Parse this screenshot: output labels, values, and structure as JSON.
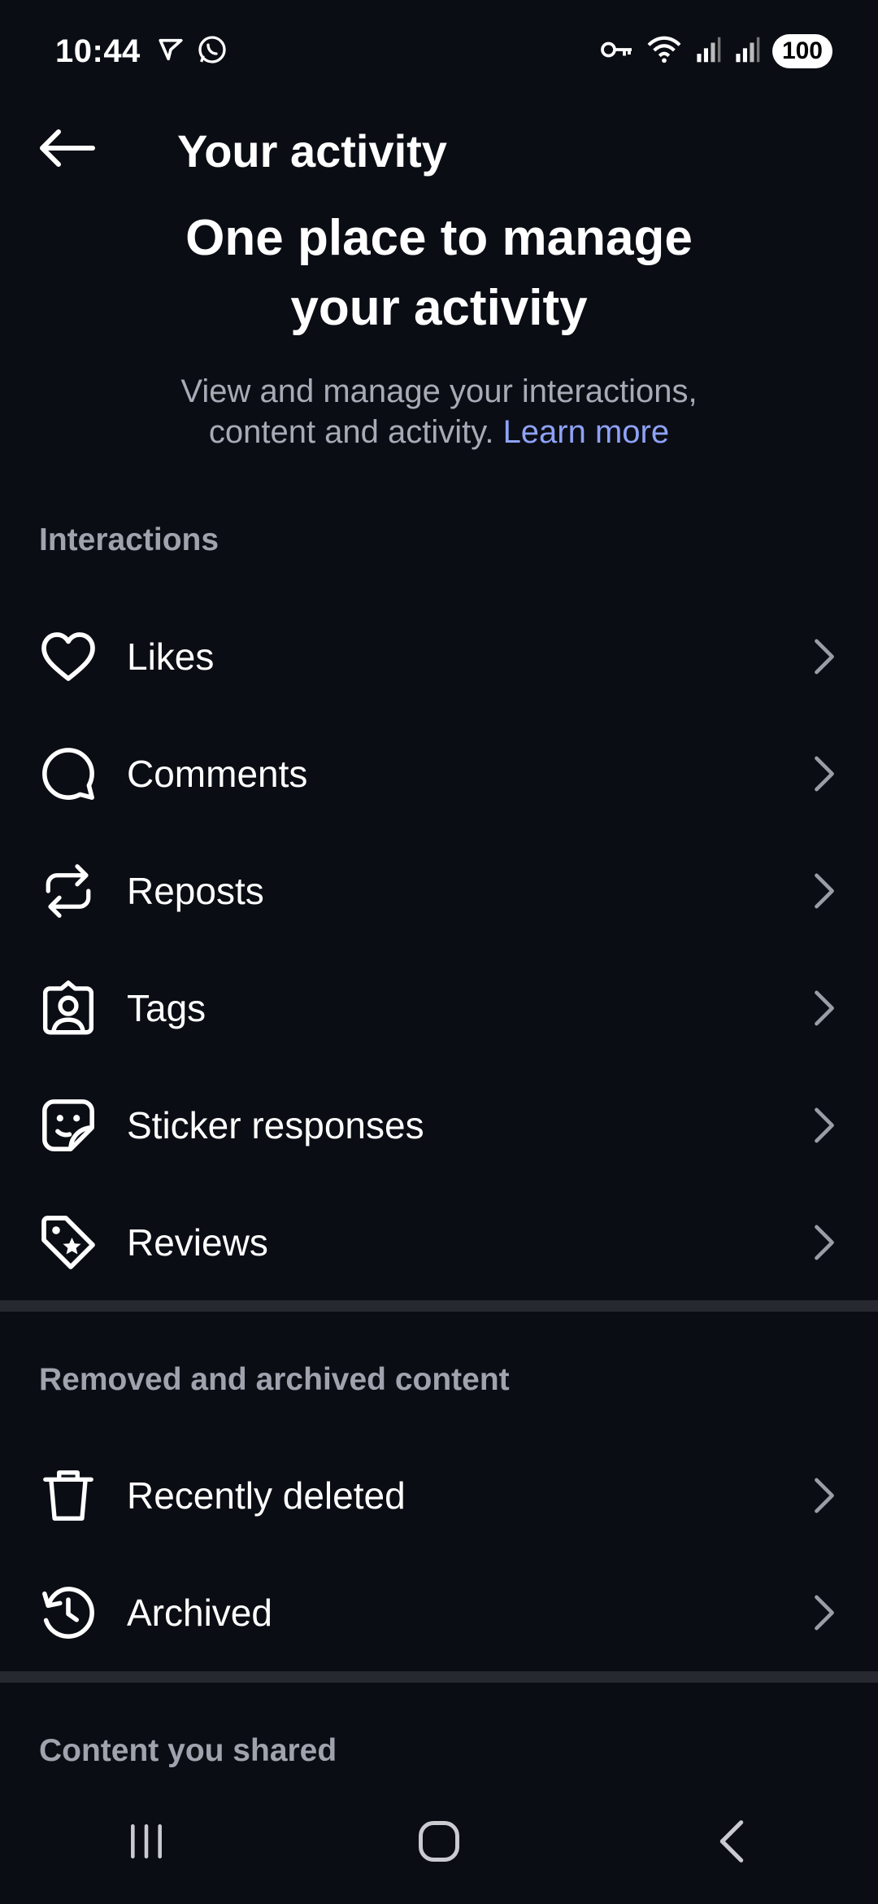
{
  "status_bar": {
    "time": "10:44",
    "battery": "100",
    "icons": [
      "navigation-icon",
      "whatsapp-icon",
      "vpn-key-icon",
      "wifi-icon",
      "signal-icon",
      "signal-icon"
    ]
  },
  "header": {
    "title": "Your activity",
    "back_icon": "arrow-left-icon"
  },
  "hero": {
    "title_line1": "One place to manage",
    "title_line2": "your activity",
    "subtitle_line1": "View and manage your interactions,",
    "subtitle_line2": "content and activity.",
    "learn_more": "Learn more"
  },
  "sections": {
    "interactions": {
      "label": "Interactions",
      "items": [
        {
          "label": "Likes",
          "icon": "heart-icon"
        },
        {
          "label": "Comments",
          "icon": "comment-icon"
        },
        {
          "label": "Reposts",
          "icon": "repost-icon"
        },
        {
          "label": "Tags",
          "icon": "tag-person-icon"
        },
        {
          "label": "Sticker responses",
          "icon": "sticker-icon"
        },
        {
          "label": "Reviews",
          "icon": "review-tag-icon"
        }
      ]
    },
    "removed": {
      "label": "Removed and archived content",
      "items": [
        {
          "label": "Recently deleted",
          "icon": "trash-icon"
        },
        {
          "label": "Archived",
          "icon": "archive-history-icon"
        }
      ]
    },
    "shared": {
      "label": "Content you shared"
    }
  },
  "colors": {
    "background": "#0b0d14",
    "divider": "#262930",
    "link": "#8ea2f7",
    "muted": "#a0a3ad"
  }
}
